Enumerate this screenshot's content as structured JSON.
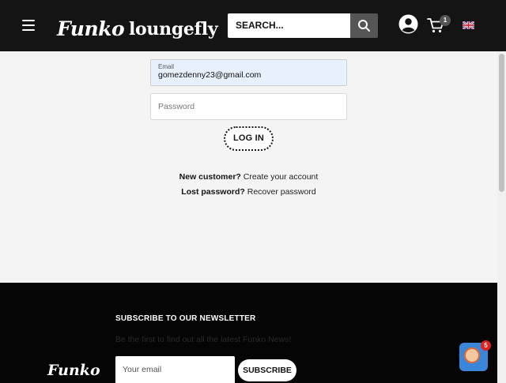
{
  "header": {
    "brand_funko": "Funko",
    "brand_loungefly": "loungefly",
    "search_placeholder": "SEARCH...",
    "cart_count": "1",
    "colors": {
      "bg": "#141414",
      "search_button": "#555555"
    }
  },
  "login": {
    "email_label": "Email",
    "email_value": "gomezdenny23@gmail.com",
    "password_placeholder": "Password",
    "login_label": "LOG IN",
    "new_customer_q": "New customer?",
    "create_account_link": "Create your account",
    "lost_password_q": "Lost password?",
    "recover_link": "Recover password"
  },
  "footer": {
    "newsletter_title": "SUBSCRIBE TO OUR NEWSLETTER",
    "newsletter_subtitle": "Be the first to find out all the latest Funko News!",
    "brand_funko": "Funko",
    "email_placeholder": "Your email",
    "subscribe_label": "SUBSCRIBE"
  },
  "chat": {
    "badge_count": "5"
  },
  "icons": [
    "menu-icon",
    "search-icon",
    "account-icon",
    "cart-icon",
    "uk-flag-icon",
    "chat-widget-icon"
  ]
}
